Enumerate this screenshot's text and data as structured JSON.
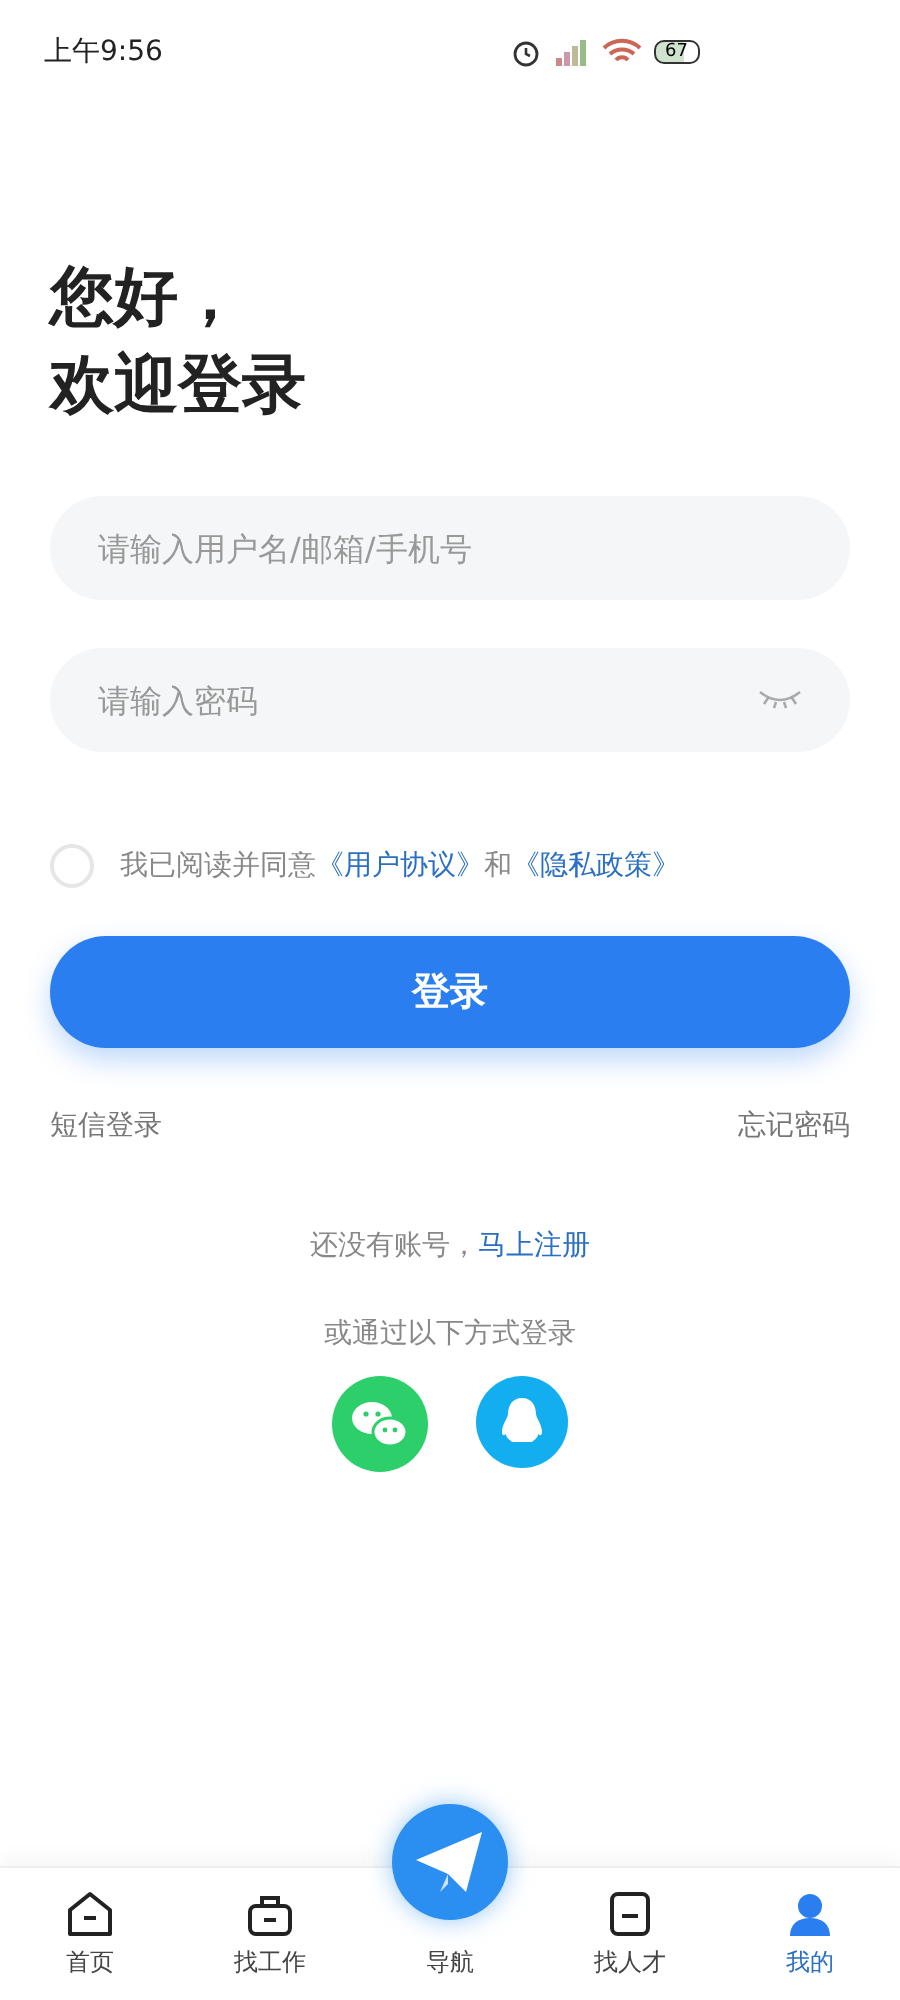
{
  "status_bar": {
    "time": "上午9:56",
    "battery": "67"
  },
  "greeting": {
    "line_1": "您好，",
    "line_2": "欢迎登录"
  },
  "username_field": {
    "placeholder": "请输入用户名/邮箱/手机号"
  },
  "password_field": {
    "placeholder": "请输入密码"
  },
  "agreement": {
    "checked": false,
    "text": "我已阅读并同意",
    "link_1": "《用户协议》",
    "joiner": "和",
    "link_2": "《隐私政策》"
  },
  "login_button": "登录",
  "links": {
    "sms_login": "短信登录",
    "forgot_password": "忘记密码"
  },
  "register": {
    "prompt": "还没有账号，",
    "link": "马上注册"
  },
  "other_login": {
    "label": "或通过以下方式登录",
    "methods": [
      {
        "kind": "wechat"
      },
      {
        "kind": "qq"
      }
    ]
  },
  "tab_bar": [
    {
      "kind": "home",
      "label": "首页",
      "selected": false
    },
    {
      "kind": "job",
      "label": "找工作",
      "selected": false
    },
    {
      "kind": "nav",
      "label": "导航",
      "selected": false
    },
    {
      "kind": "talent",
      "label": "找人才",
      "selected": false
    },
    {
      "kind": "me",
      "label": "我的",
      "selected": true
    }
  ]
}
